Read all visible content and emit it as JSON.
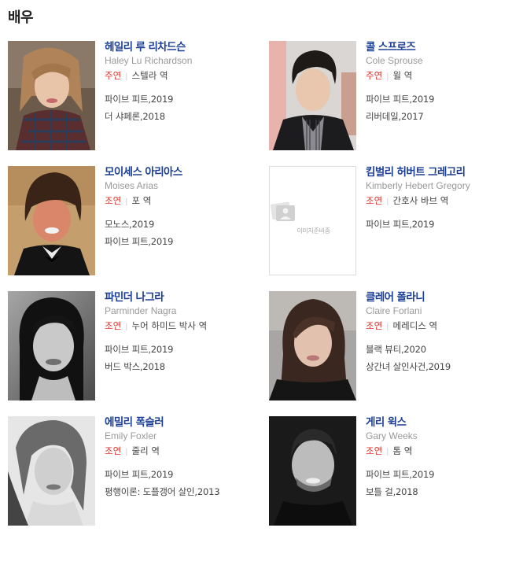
{
  "section_title": "배우",
  "actors": [
    {
      "name": "헤일리 루 리차드슨",
      "en": "Haley Lu Richardson",
      "role_type": "주연",
      "role": "스텔라 역",
      "films": [
        "파이브 피트,2019",
        "더 샤페론,2018"
      ],
      "photo": "haley-photo"
    },
    {
      "name": "콜 스프로즈",
      "en": "Cole Sprouse",
      "role_type": "주연",
      "role": "윌 역",
      "films": [
        "파이브 피트,2019",
        "리버데일,2017"
      ],
      "photo": "cole-photo"
    },
    {
      "name": "모이세스 아리아스",
      "en": "Moises Arias",
      "role_type": "조연",
      "role": "포 역",
      "films": [
        "모노스,2019",
        "파이브 피트,2019"
      ],
      "photo": "moises-photo"
    },
    {
      "name": "킴벌리 허버트 그레고리",
      "en": "Kimberly Hebert Gregory",
      "role_type": "조연",
      "role": "간호사 바브 역",
      "films": [
        "파이브 피트,2019"
      ],
      "photo": "placeholder",
      "placeholder_text": "이미지준비중"
    },
    {
      "name": "파민더 나그라",
      "en": "Parminder Nagra",
      "role_type": "조연",
      "role": "누어 하미드 박사 역",
      "films": [
        "파이브 피트,2019",
        "버드 박스,2018"
      ],
      "photo": "parminder-photo"
    },
    {
      "name": "클레어 폴라니",
      "en": "Claire Forlani",
      "role_type": "조연",
      "role": "메레디스 역",
      "films": [
        "블랙 뷰티,2020",
        "상간녀 살인사건,2019"
      ],
      "photo": "claire-photo"
    },
    {
      "name": "에밀리 폭슬러",
      "en": "Emily Foxler",
      "role_type": "조연",
      "role": "줄리 역",
      "films": [
        "파이브 피트,2019",
        "평행이론: 도플갱어 살인,2013"
      ],
      "photo": "emily-photo"
    },
    {
      "name": "게리 윅스",
      "en": "Gary Weeks",
      "role_type": "조연",
      "role": "톰 역",
      "films": [
        "파이브 피트,2019",
        "보틀 걸,2018"
      ],
      "photo": "gary-photo"
    }
  ]
}
